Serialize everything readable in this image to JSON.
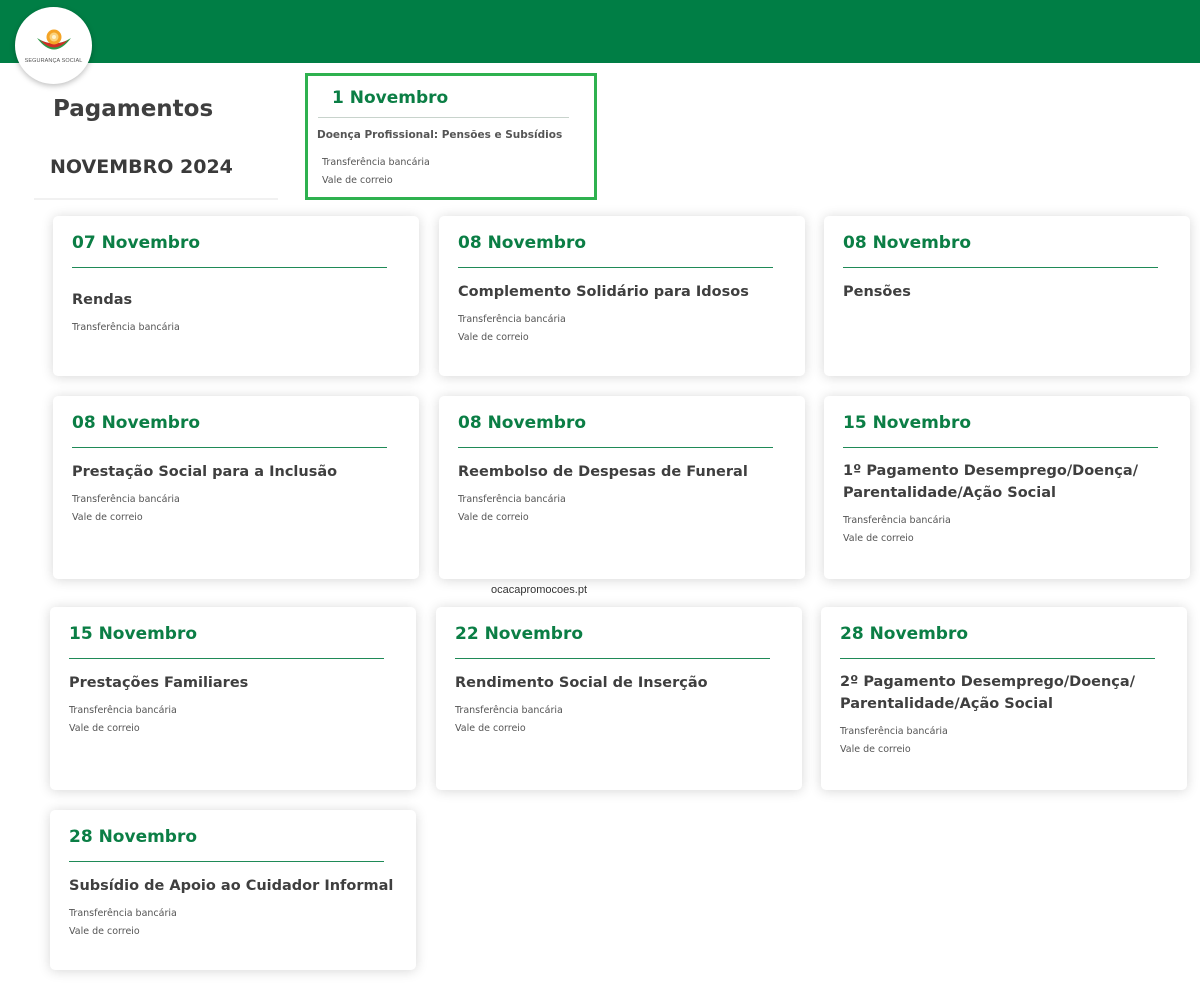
{
  "brand": {
    "logo_caption": "SEGURANÇA SOCIAL"
  },
  "page": {
    "title": "Pagamentos",
    "month": "NOVEMBRO 2024"
  },
  "featured": {
    "date": "1 Novembro",
    "title": "Doença Profissional: Pensões e Subsídios",
    "methods": [
      "Transferência bancária",
      "Vale de correio"
    ]
  },
  "cards": [
    {
      "date": "07 Novembro",
      "title": [
        "Rendas"
      ],
      "methods": [
        "Transferência bancária"
      ]
    },
    {
      "date": "08 Novembro",
      "title": [
        "Complemento Solidário para Idosos"
      ],
      "methods": [
        "Transferência bancária",
        "Vale de correio"
      ]
    },
    {
      "date": "08 Novembro",
      "title": [
        "Pensões"
      ],
      "methods": []
    },
    {
      "date": "08 Novembro",
      "title": [
        "Prestação Social para a Inclusão"
      ],
      "methods": [
        "Transferência bancária",
        "Vale de correio"
      ]
    },
    {
      "date": "08 Novembro",
      "title": [
        "Reembolso de Despesas de Funeral"
      ],
      "methods": [
        "Transferência bancária",
        "Vale de correio"
      ]
    },
    {
      "date": "15 Novembro",
      "title": [
        "1º Pagamento Desemprego/Doença/",
        "Parentalidade/Ação Social"
      ],
      "methods": [
        "Transferência bancária",
        "Vale de correio"
      ]
    },
    {
      "date": "15 Novembro",
      "title": [
        "Prestações Familiares"
      ],
      "methods": [
        "Transferência bancária",
        "Vale de correio"
      ]
    },
    {
      "date": "22 Novembro",
      "title": [
        "Rendimento Social de Inserção"
      ],
      "methods": [
        "Transferência bancária",
        "Vale de correio"
      ]
    },
    {
      "date": "28 Novembro",
      "title": [
        "2º Pagamento Desemprego/Doença/",
        "Parentalidade/Ação Social"
      ],
      "methods": [
        "Transferência bancária",
        "Vale de correio"
      ]
    },
    {
      "date": "28 Novembro",
      "title": [
        "Subsídio de Apoio ao Cuidador Informal"
      ],
      "methods": [
        "Transferência bancária",
        "Vale de correio"
      ]
    }
  ],
  "watermark": "ocacapromocoes.pt",
  "colors": {
    "brand_green": "#007e45",
    "date_green": "#0b7e45",
    "highlight_border": "#2eb14f"
  }
}
